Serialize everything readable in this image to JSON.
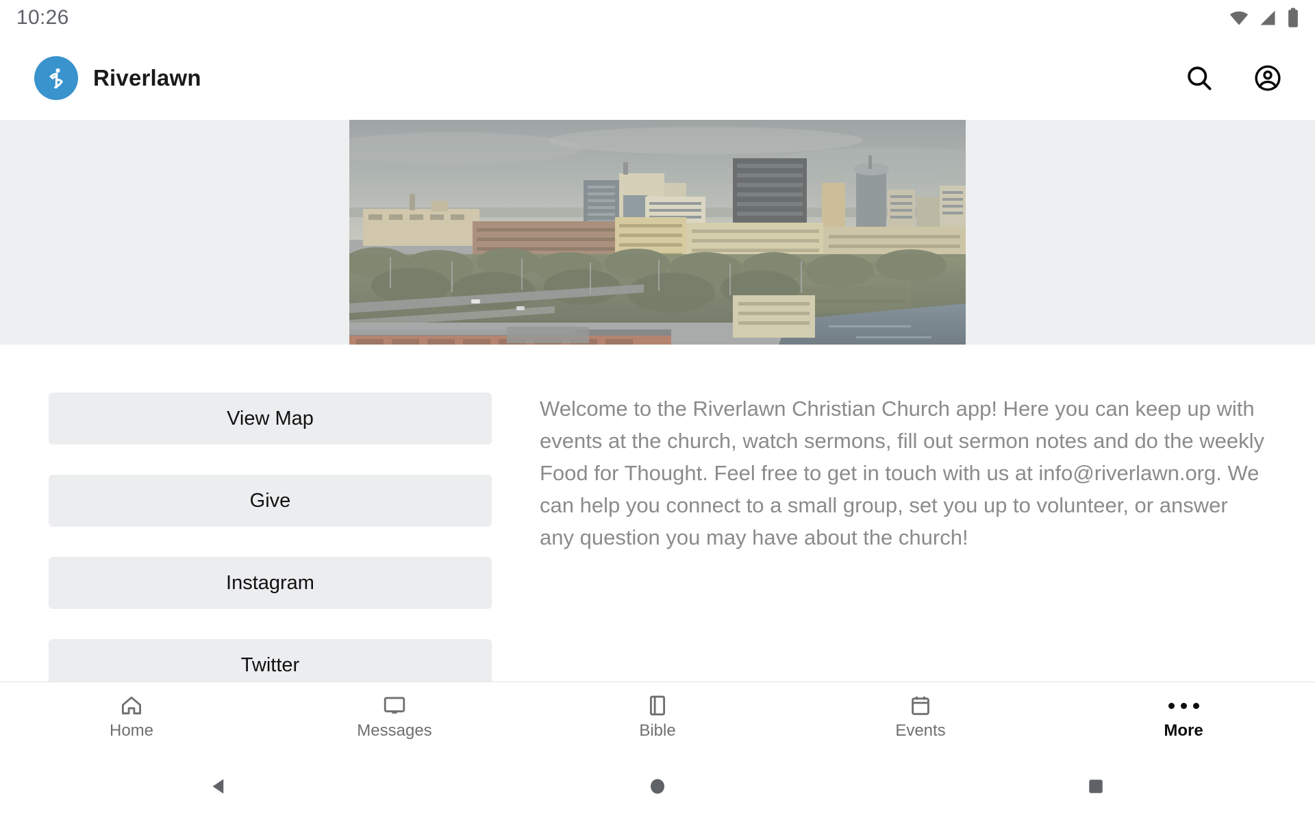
{
  "status_bar": {
    "clock": "10:26",
    "icons": [
      "wifi-icon",
      "cell-signal-icon",
      "battery-icon"
    ]
  },
  "header": {
    "brand_title": "Riverlawn",
    "logo_icon": "riverlawn-runner-logo",
    "logo_color": "#3993cd",
    "actions": [
      {
        "name": "search-icon",
        "label": "Search"
      },
      {
        "name": "account-circle-icon",
        "label": "Account"
      }
    ]
  },
  "hero": {
    "background_color": "#eeeff0",
    "image_alt": "Downtown city skyline with river and parking structures",
    "image_icon": "city-skyline-photo"
  },
  "main": {
    "buttons": [
      {
        "label": "View Map"
      },
      {
        "label": "Give"
      },
      {
        "label": "Instagram"
      },
      {
        "label": "Twitter"
      }
    ],
    "welcome_text": "Welcome to the Riverlawn Christian Church app! Here you can keep up with events at the church, watch sermons, fill out sermon notes and do the weekly Food for Thought. Feel free to get in touch with us at info@riverlawn.org. We can help you connect to a small group, set you up to volunteer, or answer any question you may have about the church!"
  },
  "tabbar": {
    "active": "More",
    "items": [
      {
        "label": "Home",
        "icon": "home-icon"
      },
      {
        "label": "Messages",
        "icon": "monitor-icon"
      },
      {
        "label": "Bible",
        "icon": "book-icon"
      },
      {
        "label": "Events",
        "icon": "calendar-icon"
      },
      {
        "label": "More",
        "icon": "more-dots-icon"
      }
    ]
  },
  "system_nav": {
    "items": [
      {
        "label": "Back",
        "icon": "back-triangle-icon"
      },
      {
        "label": "Home",
        "icon": "home-circle-icon"
      },
      {
        "label": "Recents",
        "icon": "recents-square-icon"
      }
    ]
  },
  "colors": {
    "brand_blue": "#3993cd",
    "tile_gray": "#ecedef",
    "hero_gray": "#eeeff0",
    "body_text": "#8b8b8b",
    "tab_inactive": "#6f6f6f",
    "tab_active": "#0d0d0d"
  }
}
